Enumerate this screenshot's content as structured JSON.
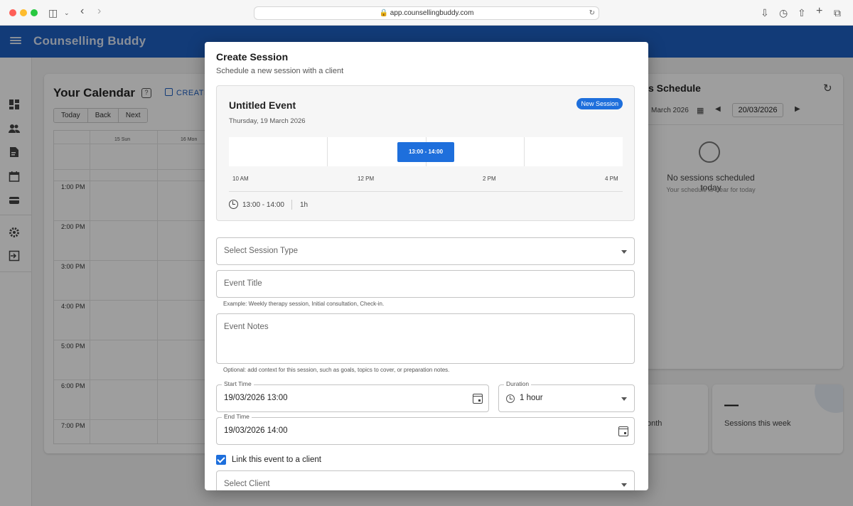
{
  "browser": {
    "url": "app.counsellingbuddy.com"
  },
  "app": {
    "brand": "Counselling Buddy",
    "accent": "#1e5fc2"
  },
  "sidebar": {
    "icons": [
      "dashboard-icon",
      "people-icon",
      "document-icon",
      "calendar-icon",
      "wallet-icon",
      "settings-icon",
      "logout-icon"
    ]
  },
  "calendar": {
    "title": "Your Calendar",
    "help_label": "?",
    "create_label": "CREATE",
    "nav": [
      "Today",
      "Back",
      "Next"
    ],
    "days": [
      "15 Sun",
      "16 Mon"
    ],
    "hours": [
      "1:00 PM",
      "2:00 PM",
      "3:00 PM",
      "4:00 PM",
      "5:00 PM",
      "6:00 PM",
      "7:00 PM"
    ]
  },
  "schedule": {
    "title_fragment": "s Schedule",
    "date_fragment": "March 2026",
    "date_value": "20/03/2026",
    "empty_title": "No sessions scheduled today",
    "empty_sub": "Your schedule is clear for today"
  },
  "stats": {
    "month_fragment": "onth",
    "week_value": "—",
    "week_label": "Sessions this week"
  },
  "dialog": {
    "title": "Create Session",
    "subtitle": "Schedule a new session with a client",
    "preview": {
      "event_title": "Untitled Event",
      "date": "Thursday, 19 March 2026",
      "chip": "New Session",
      "block_label": "13:00 - 14:00",
      "axis": [
        "10 AM",
        "12 PM",
        "2 PM",
        "4 PM"
      ],
      "time_range": "13:00 - 14:00",
      "duration": "1h"
    },
    "session_type": {
      "placeholder": "Select Session Type"
    },
    "event_title_field": {
      "placeholder": "Event Title",
      "helper": "Example: Weekly therapy session, Initial consultation, Check-in."
    },
    "event_notes": {
      "placeholder": "Event Notes",
      "helper": "Optional: add context for this session, such as goals, topics to cover, or preparation notes."
    },
    "start_time": {
      "label": "Start Time",
      "value": "19/03/2026 13:00"
    },
    "duration": {
      "label": "Duration",
      "value": "1 hour"
    },
    "end_time": {
      "label": "End Time",
      "value": "19/03/2026 14:00"
    },
    "link_client": {
      "label": "Link this event to a client",
      "checked": true
    },
    "client": {
      "placeholder": "Select Client"
    }
  }
}
